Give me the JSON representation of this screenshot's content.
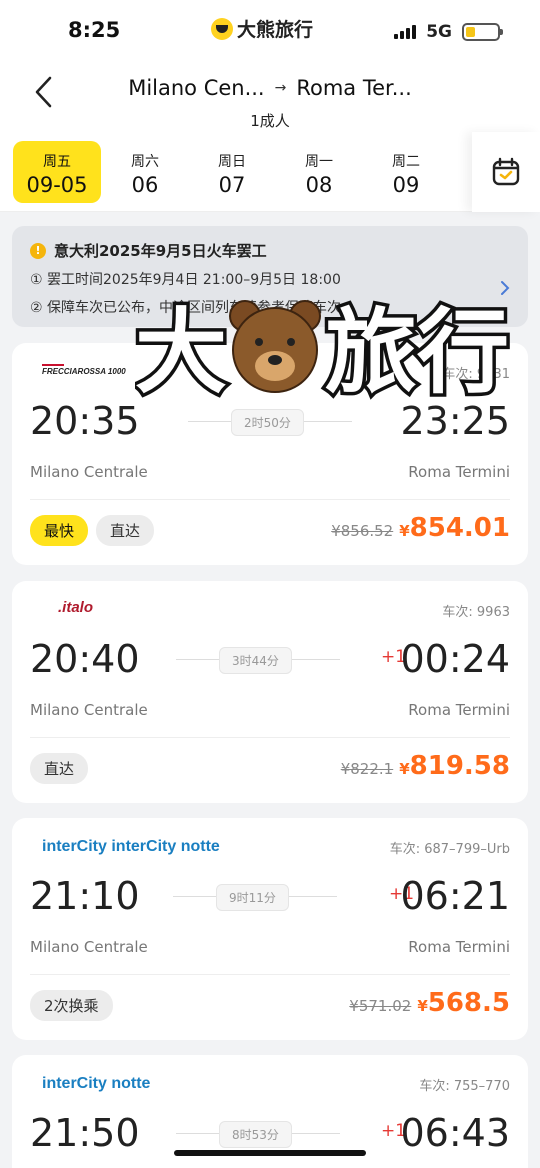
{
  "status_bar": {
    "time": "8:25",
    "app_name": "大熊旅行",
    "network": "5G"
  },
  "header": {
    "from": "Milano Cen...",
    "to": "Roma Ter...",
    "passengers": "1成人"
  },
  "dates": [
    {
      "weekday": "周五",
      "date": "09-05",
      "active": true
    },
    {
      "weekday": "周六",
      "date": "06",
      "active": false
    },
    {
      "weekday": "周日",
      "date": "07",
      "active": false
    },
    {
      "weekday": "周一",
      "date": "08",
      "active": false
    },
    {
      "weekday": "周二",
      "date": "09",
      "active": false
    }
  ],
  "notice": {
    "title": "意大利2025年9月5日火车罢工",
    "line1": "① 罢工时间2025年9月4日 21:00–9月5日 18:00",
    "line2": "② 保障车次已公布，中途区间列车请参考保障车次"
  },
  "trains": [
    {
      "operator": "FRECCIAROSSA 1000",
      "train_no": "车次: 9531",
      "dep_time": "20:35",
      "arr_time": "23:25",
      "day_offset": "",
      "duration": "2时50分",
      "dep_station": "Milano Centrale",
      "arr_station": "Roma Termini",
      "tags": [
        "最快",
        "直达"
      ],
      "old_price": "¥856.52",
      "currency": "¥",
      "price": "854.01"
    },
    {
      "operator": ".italo",
      "train_no": "车次: 9963",
      "dep_time": "20:40",
      "arr_time": "00:24",
      "day_offset": "+1",
      "duration": "3时44分",
      "dep_station": "Milano Centrale",
      "arr_station": "Roma Termini",
      "tags": [
        "直达"
      ],
      "old_price": "¥822.1",
      "currency": "¥",
      "price": "819.58"
    },
    {
      "operator": "interCity interCity notte",
      "train_no": "车次: 687–799–Urb",
      "dep_time": "21:10",
      "arr_time": "06:21",
      "day_offset": "+1",
      "duration": "9时11分",
      "dep_station": "Milano Centrale",
      "arr_station": "Roma Termini",
      "tags": [
        "2次换乘"
      ],
      "old_price": "¥571.02",
      "currency": "¥",
      "price": "568.5"
    },
    {
      "operator": "interCity notte",
      "train_no": "车次: 755–770",
      "dep_time": "21:50",
      "arr_time": "06:43",
      "day_offset": "+1",
      "duration": "8时53分"
    }
  ],
  "watermark": {
    "text_left": "大",
    "text_right": "旅行"
  },
  "colors": {
    "accent": "#ffe21c",
    "price": "#ff6b1a",
    "offset": "#e53935"
  }
}
